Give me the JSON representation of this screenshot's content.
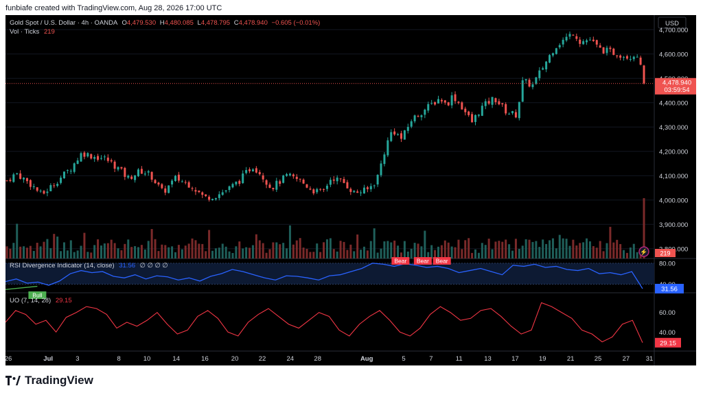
{
  "header": {
    "attribution": "funbiafe created with TradingView.com, Aug 28, 2026 17:00 UTC"
  },
  "legend": {
    "symbol": "Gold Spot / U.S. Dollar · 4h · OANDA",
    "o_label": "O",
    "o_value": "4,479.530",
    "h_label": "H",
    "h_value": "4,480.085",
    "l_label": "L",
    "l_value": "4,478.795",
    "c_label": "C",
    "c_value": "4,478.940",
    "change": "−0.605 (−0.01%)",
    "vol_label": "Vol · Ticks",
    "vol_value": "219"
  },
  "price_axis": {
    "currency": "USD",
    "ticks": [
      "4,700.000",
      "4,600.000",
      "4,500.000",
      "4,400.000",
      "4,300.000",
      "4,200.000",
      "4,100.000",
      "4,000.000",
      "3,900.000",
      "3,800.000"
    ],
    "last_price": "4,478.940",
    "countdown": "03:59:54",
    "volume_badge": "219"
  },
  "rsi": {
    "title": "RSI Divergence Indicator (14, close)",
    "value": "31.56",
    "flags": "∅ ∅ ∅ ∅",
    "ticks": [
      "80.00",
      "40.00"
    ],
    "labels": [
      "Bull",
      "Bear",
      "Bear",
      "Bear"
    ]
  },
  "uo": {
    "title": "UO (7, 14, 28)",
    "value": "29.15",
    "ticks": [
      "60.00",
      "40.00"
    ]
  },
  "time_axis": [
    "26",
    "Jul",
    "3",
    "8",
    "10",
    "14",
    "16",
    "20",
    "22",
    "24",
    "28",
    "Aug",
    "5",
    "7",
    "11",
    "13",
    "17",
    "19",
    "21",
    "25",
    "27",
    "31"
  ],
  "footer": {
    "brand": "TradingView"
  },
  "colors": {
    "up": "#26a69a",
    "down": "#ef5350",
    "rsi": "#2962ff",
    "uo": "#f23645",
    "bg": "#000000"
  },
  "chart_data": [
    {
      "type": "candlestick",
      "title": "Gold Spot / U.S. Dollar · 4h · OANDA",
      "ylabel": "USD",
      "ylim": [
        3760,
        4760
      ],
      "last": 4478.94,
      "x_ticks": [
        "26",
        "Jul",
        "3",
        "8",
        "10",
        "14",
        "16",
        "20",
        "22",
        "24",
        "28",
        "Aug",
        "5",
        "7",
        "11",
        "13",
        "17",
        "19",
        "21",
        "25",
        "27",
        "31"
      ],
      "close_path": [
        {
          "t": 0,
          "p": 4080
        },
        {
          "t": 0.015,
          "p": 4110
        },
        {
          "t": 0.04,
          "p": 4060
        },
        {
          "t": 0.055,
          "p": 4020
        },
        {
          "t": 0.075,
          "p": 4070
        },
        {
          "t": 0.1,
          "p": 4130
        },
        {
          "t": 0.118,
          "p": 4195
        },
        {
          "t": 0.135,
          "p": 4180
        },
        {
          "t": 0.155,
          "p": 4170
        },
        {
          "t": 0.175,
          "p": 4130
        },
        {
          "t": 0.19,
          "p": 4090
        },
        {
          "t": 0.21,
          "p": 4120
        },
        {
          "t": 0.225,
          "p": 4105
        },
        {
          "t": 0.245,
          "p": 4030
        },
        {
          "t": 0.265,
          "p": 4090
        },
        {
          "t": 0.29,
          "p": 4060
        },
        {
          "t": 0.31,
          "p": 4010
        },
        {
          "t": 0.33,
          "p": 4020
        },
        {
          "t": 0.35,
          "p": 4050
        },
        {
          "t": 0.365,
          "p": 4080
        },
        {
          "t": 0.385,
          "p": 4140
        },
        {
          "t": 0.395,
          "p": 4120
        },
        {
          "t": 0.415,
          "p": 4050
        },
        {
          "t": 0.44,
          "p": 4100
        },
        {
          "t": 0.46,
          "p": 4080
        },
        {
          "t": 0.48,
          "p": 4040
        },
        {
          "t": 0.495,
          "p": 4030
        },
        {
          "t": 0.51,
          "p": 4095
        },
        {
          "t": 0.53,
          "p": 4070
        },
        {
          "t": 0.545,
          "p": 4030
        },
        {
          "t": 0.565,
          "p": 4040
        },
        {
          "t": 0.58,
          "p": 4080
        },
        {
          "t": 0.595,
          "p": 4220
        },
        {
          "t": 0.605,
          "p": 4290
        },
        {
          "t": 0.62,
          "p": 4250
        },
        {
          "t": 0.635,
          "p": 4330
        },
        {
          "t": 0.66,
          "p": 4380
        },
        {
          "t": 0.68,
          "p": 4420
        },
        {
          "t": 0.69,
          "p": 4390
        },
        {
          "t": 0.7,
          "p": 4430
        },
        {
          "t": 0.715,
          "p": 4380
        },
        {
          "t": 0.73,
          "p": 4320
        },
        {
          "t": 0.745,
          "p": 4380
        },
        {
          "t": 0.765,
          "p": 4420
        },
        {
          "t": 0.785,
          "p": 4360
        },
        {
          "t": 0.8,
          "p": 4350
        },
        {
          "t": 0.81,
          "p": 4490
        },
        {
          "t": 0.825,
          "p": 4470
        },
        {
          "t": 0.84,
          "p": 4540
        },
        {
          "t": 0.86,
          "p": 4630
        },
        {
          "t": 0.875,
          "p": 4660
        },
        {
          "t": 0.89,
          "p": 4690
        },
        {
          "t": 0.9,
          "p": 4650
        },
        {
          "t": 0.915,
          "p": 4660
        },
        {
          "t": 0.93,
          "p": 4620
        },
        {
          "t": 0.945,
          "p": 4610
        },
        {
          "t": 0.96,
          "p": 4600
        },
        {
          "t": 0.975,
          "p": 4590
        },
        {
          "t": 0.99,
          "p": 4600
        },
        {
          "t": 1,
          "p": 4478.94
        }
      ]
    },
    {
      "type": "line",
      "title": "RSI Divergence Indicator (14, close)",
      "ylim": [
        25,
        85
      ],
      "ticks": [
        80,
        40
      ],
      "last": 31.56,
      "values": [
        45,
        50,
        42,
        44,
        38,
        46,
        60,
        66,
        62,
        64,
        55,
        52,
        58,
        50,
        56,
        54,
        48,
        52,
        46,
        55,
        60,
        68,
        64,
        58,
        52,
        48,
        56,
        55,
        52,
        48,
        56,
        58,
        64,
        70,
        80,
        78,
        74,
        79,
        76,
        72,
        74,
        70,
        62,
        66,
        70,
        64,
        58,
        76,
        74,
        78,
        72,
        74,
        68,
        66,
        70,
        60,
        62,
        58,
        64,
        31.56
      ],
      "markers": [
        {
          "label": "Bull",
          "t": 0.05
        },
        {
          "label": "Bear",
          "t": 0.62
        },
        {
          "label": "Bear",
          "t": 0.655
        },
        {
          "label": "Bear",
          "t": 0.685
        }
      ]
    },
    {
      "type": "line",
      "title": "UO (7, 14, 28)",
      "ylim": [
        22,
        78
      ],
      "ticks": [
        60,
        40
      ],
      "last": 29.15,
      "values": [
        50,
        62,
        58,
        48,
        52,
        40,
        55,
        60,
        66,
        64,
        58,
        44,
        50,
        46,
        52,
        60,
        48,
        38,
        42,
        56,
        62,
        54,
        40,
        36,
        50,
        58,
        64,
        56,
        48,
        44,
        52,
        60,
        56,
        42,
        36,
        48,
        56,
        62,
        52,
        40,
        36,
        44,
        58,
        66,
        60,
        52,
        54,
        62,
        64,
        56,
        46,
        38,
        42,
        70,
        66,
        60,
        54,
        42,
        38,
        30,
        35,
        48,
        52,
        29.15
      ]
    }
  ]
}
